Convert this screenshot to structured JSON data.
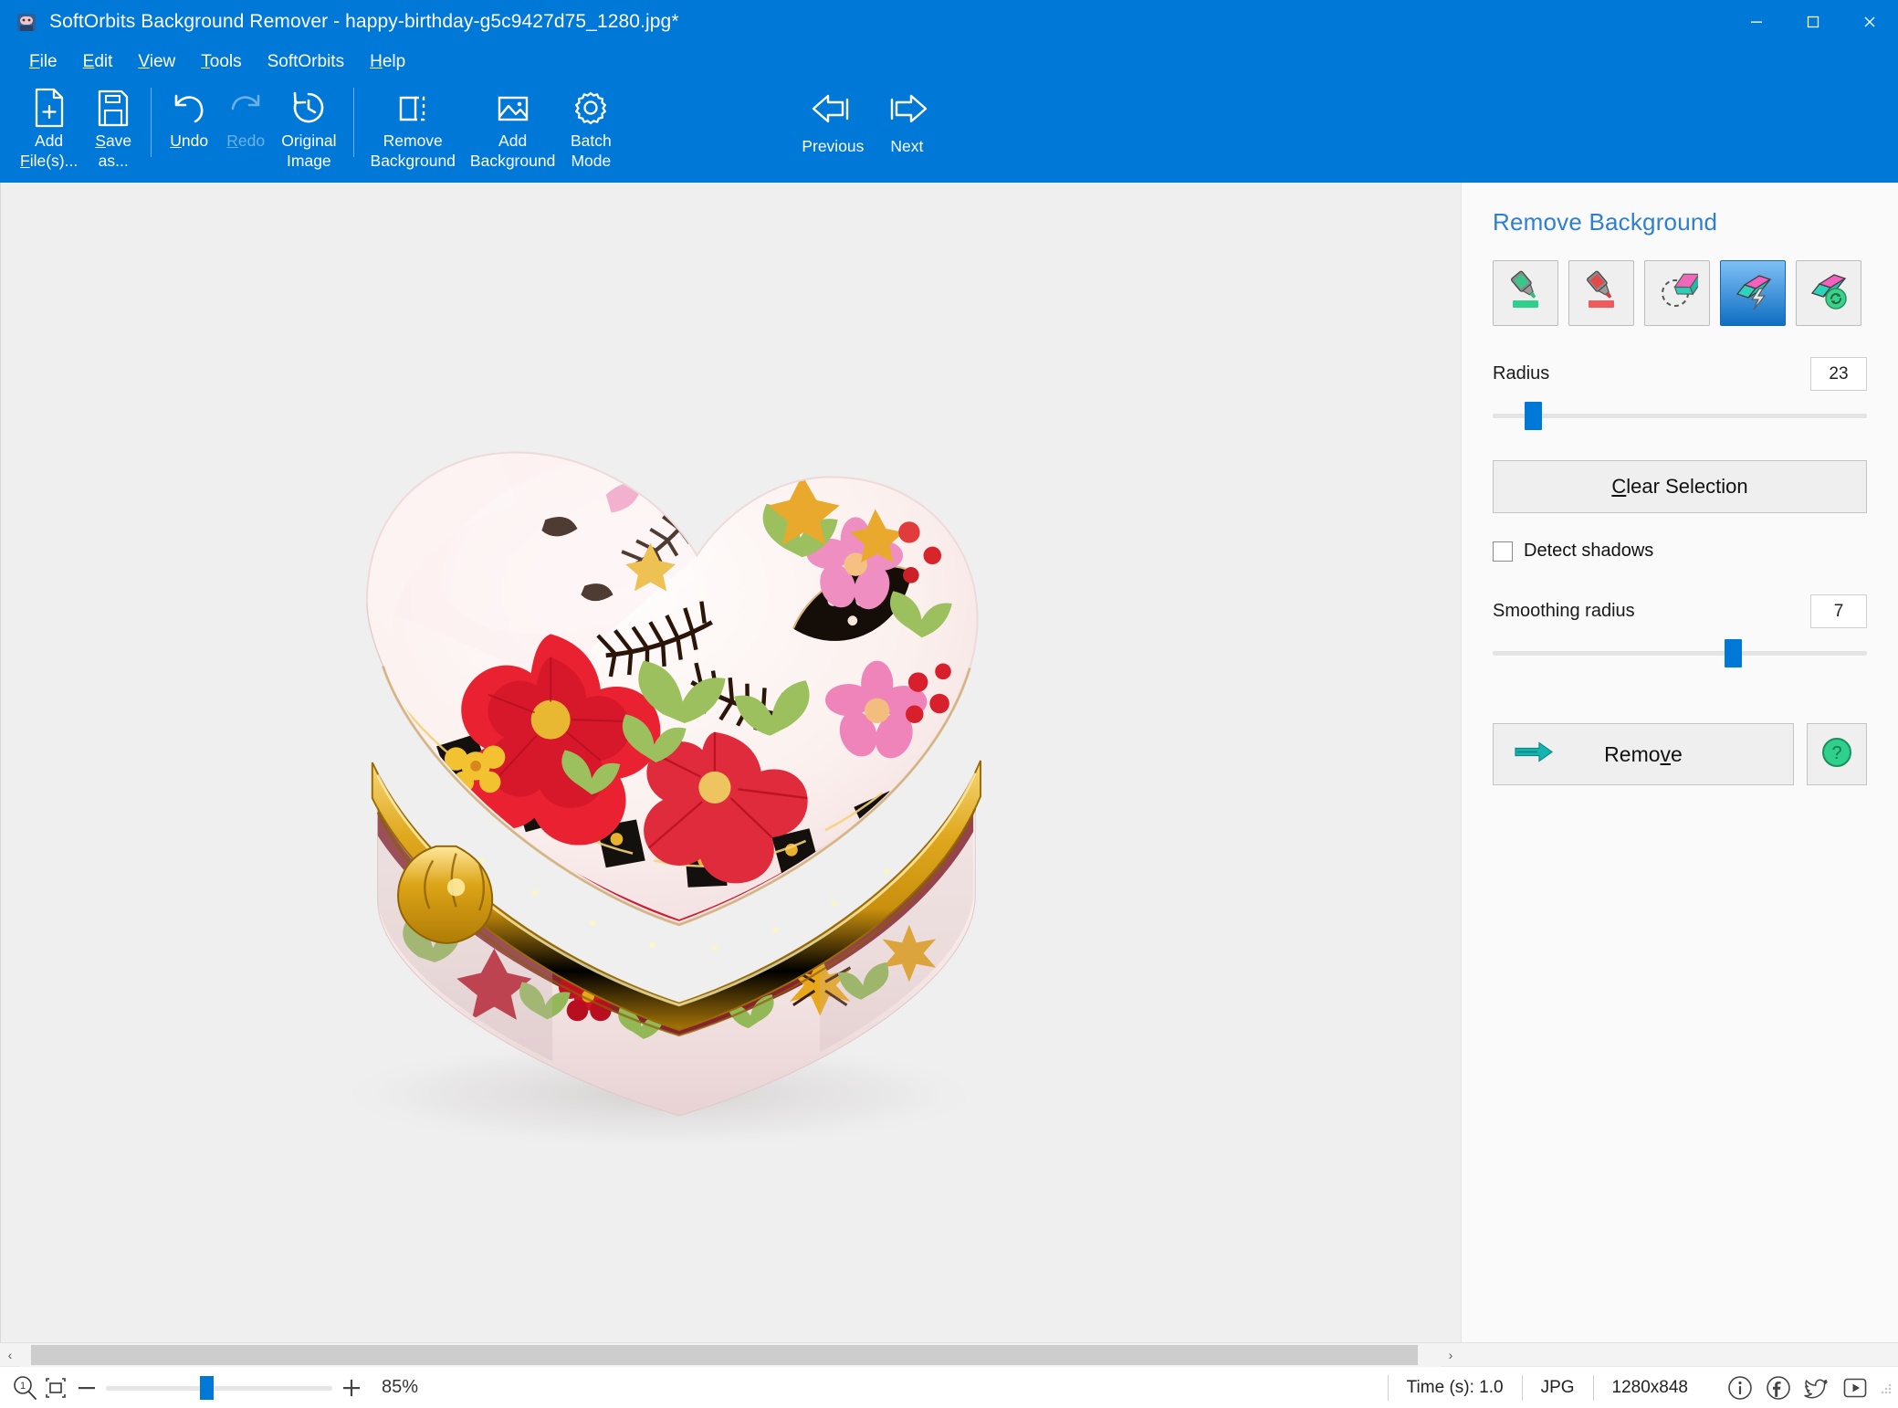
{
  "window": {
    "title": "SoftOrbits Background Remover - happy-birthday-g5c9427d75_1280.jpg*",
    "app_icon": "app-logo-icon",
    "minimize": "–",
    "maximize": "□",
    "close": "✕",
    "accent": "#0078d7"
  },
  "menu": [
    {
      "label": "File",
      "mnemonic": "F"
    },
    {
      "label": "Edit",
      "mnemonic": "E"
    },
    {
      "label": "View",
      "mnemonic": "V"
    },
    {
      "label": "Tools",
      "mnemonic": "T"
    },
    {
      "label": "SoftOrbits",
      "mnemonic": ""
    },
    {
      "label": "Help",
      "mnemonic": "H"
    }
  ],
  "toolbar": {
    "buttons": [
      {
        "id": "add-files",
        "line1": "Add",
        "line2": "File(s)...",
        "icon": "file-plus-icon",
        "disabled": false,
        "mnemonic": "F"
      },
      {
        "id": "save-as",
        "line1": "Save",
        "line2": "as...",
        "icon": "floppy-disk-icon",
        "disabled": false,
        "mnemonic": "S"
      },
      {
        "id": "undo",
        "line1": "Undo",
        "line2": "",
        "icon": "undo-arrow-icon",
        "disabled": false,
        "mnemonic": "U"
      },
      {
        "id": "redo",
        "line1": "Redo",
        "line2": "",
        "icon": "redo-arrow-icon",
        "disabled": true,
        "mnemonic": "R"
      },
      {
        "id": "original-image",
        "line1": "Original",
        "line2": "Image",
        "icon": "history-clock-icon",
        "disabled": false,
        "mnemonic": ""
      },
      {
        "id": "remove-background",
        "line1": "Remove",
        "line2": "Background",
        "icon": "dashed-square-icon",
        "disabled": false,
        "mnemonic": ""
      },
      {
        "id": "add-background",
        "line1": "Add",
        "line2": "Background",
        "icon": "picture-icon",
        "disabled": false,
        "mnemonic": ""
      },
      {
        "id": "batch-mode",
        "line1": "Batch",
        "line2": "Mode",
        "icon": "gear-icon",
        "disabled": false,
        "mnemonic": ""
      }
    ],
    "nav": [
      {
        "id": "previous",
        "label": "Previous",
        "icon": "arrow-left-bar-icon"
      },
      {
        "id": "next",
        "label": "Next",
        "icon": "arrow-right-bar-icon"
      }
    ]
  },
  "panel": {
    "title": "Remove Background",
    "tools": [
      {
        "id": "mark-keep",
        "icon": "green-marker-icon",
        "selected": false
      },
      {
        "id": "mark-remove",
        "icon": "red-marker-icon",
        "selected": false
      },
      {
        "id": "eraser",
        "icon": "eraser-icon",
        "selected": false
      },
      {
        "id": "magic-wand-auto",
        "icon": "auto-layers-bolt-icon",
        "selected": true
      },
      {
        "id": "restore-layers",
        "icon": "layers-refresh-icon",
        "selected": false
      }
    ],
    "radius": {
      "label": "Radius",
      "value": "23",
      "slider_percent": 9
    },
    "clear_selection": {
      "label": "Clear Selection",
      "mnemonic": "C"
    },
    "detect_shadows": {
      "label": "Detect shadows",
      "checked": false
    },
    "smoothing_radius": {
      "label": "Smoothing radius",
      "value": "7",
      "slider_percent": 65
    },
    "remove": {
      "label": "Remove",
      "mnemonic": "v",
      "icon": "teal-arrow-icon"
    },
    "help": {
      "icon": "green-question-icon"
    }
  },
  "statusbar": {
    "zoom_icon": "zoom-1to1-icon",
    "fit_icon": "fit-to-window-icon",
    "minus": "−",
    "plus": "+",
    "zoom_value": "85%",
    "zoom_percent": 44,
    "time": "Time (s): 1.0",
    "format": "JPG",
    "dimensions": "1280x848",
    "social": [
      {
        "id": "info",
        "icon": "info-circle-icon"
      },
      {
        "id": "facebook",
        "icon": "facebook-icon"
      },
      {
        "id": "twitter",
        "icon": "twitter-bird-icon"
      },
      {
        "id": "youtube",
        "icon": "youtube-play-icon"
      }
    ]
  },
  "canvas": {
    "background": "#efefef",
    "subject": "heart-shaped porcelain trinket box with floral pattern and gold trim",
    "scroll_left_arrow": "‹",
    "scroll_right_arrow": "›"
  }
}
